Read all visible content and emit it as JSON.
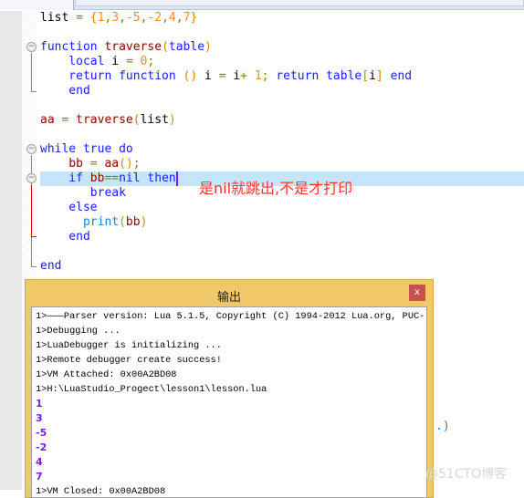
{
  "editor": {
    "lines": [
      [
        [
          "plain",
          "list"
        ],
        [
          "op",
          " = "
        ],
        [
          "par",
          "{"
        ],
        [
          "num",
          "1"
        ],
        [
          "op",
          ","
        ],
        [
          "num",
          "3"
        ],
        [
          "op",
          ","
        ],
        [
          "num",
          "-5"
        ],
        [
          "op",
          ","
        ],
        [
          "num",
          "-2"
        ],
        [
          "op",
          ","
        ],
        [
          "num",
          "4"
        ],
        [
          "op",
          ","
        ],
        [
          "num",
          "7"
        ],
        [
          "par",
          "}"
        ]
      ],
      [],
      [
        [
          "kw",
          "function "
        ],
        [
          "id",
          "traverse"
        ],
        [
          "par",
          "("
        ],
        [
          "kw",
          "table"
        ],
        [
          "par",
          ")"
        ]
      ],
      [
        [
          "kw",
          "    local "
        ],
        [
          "plain",
          "i "
        ],
        [
          "op",
          "= "
        ],
        [
          "num",
          "0"
        ],
        [
          "op",
          ";"
        ]
      ],
      [
        [
          "kw",
          "    return function "
        ],
        [
          "par",
          "() "
        ],
        [
          "plain",
          "i "
        ],
        [
          "op",
          "= "
        ],
        [
          "plain",
          "i"
        ],
        [
          "op",
          "+ "
        ],
        [
          "num",
          "1"
        ],
        [
          "op",
          "; "
        ],
        [
          "kw",
          "return "
        ],
        [
          "kw",
          "table"
        ],
        [
          "par",
          "["
        ],
        [
          "plain",
          "i"
        ],
        [
          "par",
          "] "
        ],
        [
          "kw",
          "end"
        ]
      ],
      [
        [
          "kw",
          "    end"
        ]
      ],
      [],
      [
        [
          "id",
          "aa"
        ],
        [
          "op",
          " = "
        ],
        [
          "id",
          "traverse"
        ],
        [
          "par",
          "("
        ],
        [
          "plain",
          "list"
        ],
        [
          "par",
          ")"
        ]
      ],
      [],
      [
        [
          "kw",
          "while true do"
        ]
      ],
      [
        [
          "id",
          "    bb"
        ],
        [
          "op",
          " = "
        ],
        [
          "id",
          "aa"
        ],
        [
          "par",
          "()"
        ],
        [
          "op",
          ";"
        ]
      ],
      [
        [
          "kw",
          "    if "
        ],
        [
          "id",
          "bb"
        ],
        [
          "op",
          "=="
        ],
        [
          "kw",
          "nil then"
        ]
      ],
      [
        [
          "kw",
          "       break"
        ]
      ],
      [
        [
          "kw",
          "    else"
        ]
      ],
      [
        [
          "fn",
          "      print"
        ],
        [
          "par",
          "("
        ],
        [
          "id",
          "bb"
        ],
        [
          "par",
          ")"
        ]
      ],
      [
        [
          "kw",
          "    end"
        ]
      ],
      [],
      [
        [
          "kw",
          "end"
        ]
      ]
    ],
    "annotation": "是nil就跳出,不是才打印",
    "stray_text": ".)"
  },
  "output_window": {
    "title": "输出",
    "close_label": "x",
    "log_lines": [
      "1>———Parser version: Lua 5.1.5, Copyright (C) 1994-2012 Lua.org, PUC-",
      "1>Debugging ...",
      "1>LuaDebugger is initializing ...",
      "1>Remote debugger create success!",
      "1>VM Attached: 0x00A2BD08",
      "1>H:\\LuaStudio_Progect\\lesson1\\lesson.lua"
    ],
    "printed_values": [
      "1",
      "3",
      "-5",
      "-2",
      "4",
      "7"
    ],
    "last_line": "1>VM Closed: 0x00A2BD08"
  },
  "watermark": "@51CTO博客"
}
